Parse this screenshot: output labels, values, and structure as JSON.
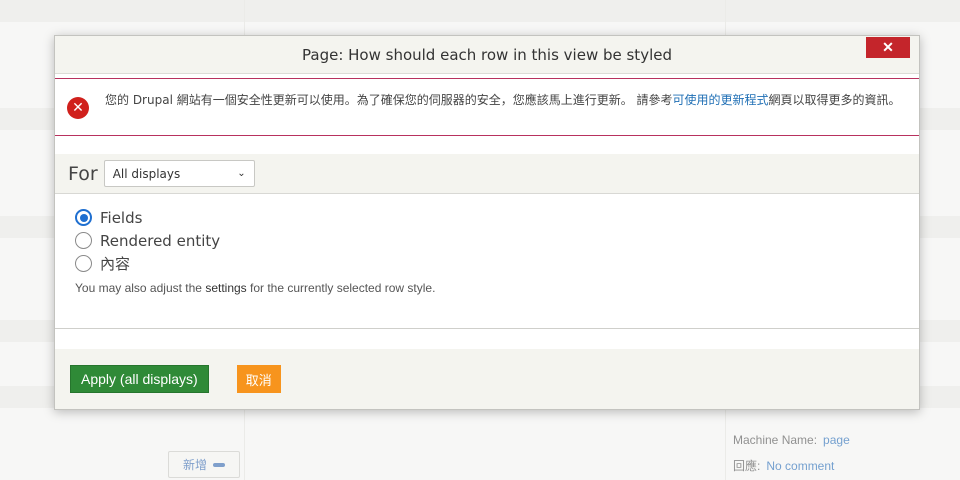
{
  "dialog": {
    "title": "Page: How should each row in this view be styled",
    "close_label": "✕"
  },
  "alert": {
    "text_before": "您的 Drupal 網站有一個安全性更新可以使用。為了確保您的伺服器的安全，您應該馬上進行更新。 請參考",
    "link_text": "可使用的更新程式",
    "text_after": "網頁以取得更多的資訊。"
  },
  "for_row": {
    "label": "For",
    "selected": "All displays"
  },
  "options": [
    {
      "label": "Fields",
      "checked": true
    },
    {
      "label": "Rendered entity",
      "checked": false
    },
    {
      "label": "內容",
      "checked": false
    }
  ],
  "help": {
    "before": "You may also adjust the ",
    "link": "settings",
    "after": " for the currently selected row style."
  },
  "buttons": {
    "apply": "Apply (all displays)",
    "cancel": "取消"
  },
  "background": {
    "add_button": "新增",
    "machine_name_label": "Machine Name:",
    "machine_name_value": "page",
    "reply_label": "回應:",
    "reply_value": "No comment"
  },
  "colors": {
    "close": "#c4252b",
    "alert_border": "#b8315e",
    "apply": "#2f8a37",
    "cancel": "#f7941d",
    "radio": "#1f6fd0"
  }
}
